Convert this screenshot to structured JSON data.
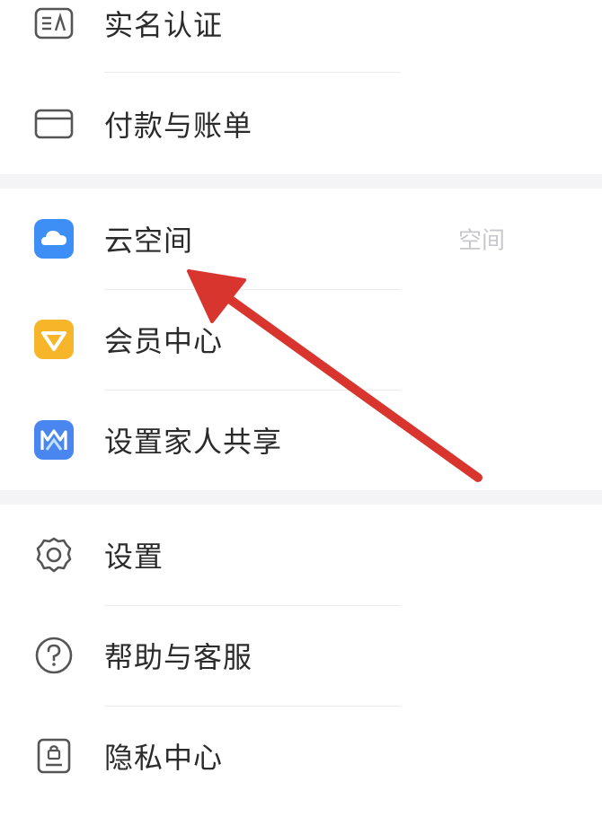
{
  "menu": {
    "items": [
      {
        "label": "实名认证",
        "icon": "id-card-icon"
      },
      {
        "label": "付款与账单",
        "icon": "card-icon"
      },
      {
        "label": "云空间",
        "icon": "cloud-icon",
        "value": "空间"
      },
      {
        "label": "会员中心",
        "icon": "member-icon"
      },
      {
        "label": "设置家人共享",
        "icon": "family-share-icon"
      },
      {
        "label": "设置",
        "icon": "gear-icon"
      },
      {
        "label": "帮助与客服",
        "icon": "help-icon"
      },
      {
        "label": "隐私中心",
        "icon": "privacy-icon"
      }
    ]
  },
  "colors": {
    "cloud_blue": "#3e8ff5",
    "member_orange": "#f7b52a",
    "family_blue": "#4a86f0",
    "arrow_red": "#d9352f"
  }
}
